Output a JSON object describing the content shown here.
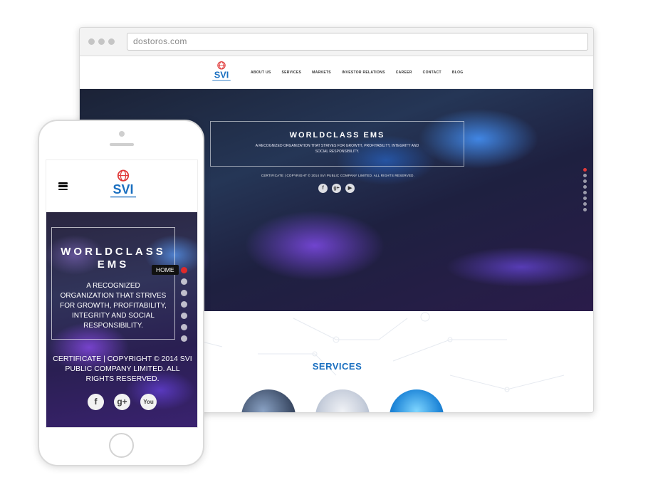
{
  "browser": {
    "url": "dostoros.com"
  },
  "brand": {
    "logo_text": "SVI",
    "accent_blue": "#1a6fc0",
    "accent_red": "#e03a3a"
  },
  "desktop_nav": {
    "items": [
      {
        "label": "ABOUT US"
      },
      {
        "label": "SERVICES"
      },
      {
        "label": "MARKETS"
      },
      {
        "label": "INVESTOR RELATIONS"
      },
      {
        "label": "CAREER"
      },
      {
        "label": "CONTACT"
      },
      {
        "label": "BLOG"
      }
    ]
  },
  "hero": {
    "title": "WORLDCLASS EMS",
    "subtitle": "A RECOGNIZED ORGANIZATION THAT STRIVES FOR GROWTH, PROFITABILITY, INTEGRITY AND SOCIAL RESPONSIBILITY.",
    "copyright": "CERTIFICATE | COPYRIGHT © 2014 SVI PUBLIC COMPANY LIMITED. ALL RIGHTS RESERVED.",
    "social": [
      {
        "icon": "facebook-icon",
        "glyph": "f"
      },
      {
        "icon": "google-plus-icon",
        "glyph": "g+"
      },
      {
        "icon": "youtube-icon",
        "glyph": "▶"
      }
    ]
  },
  "services": {
    "title": "SERVICES"
  },
  "mobile": {
    "menu_icon": "hamburger-icon",
    "title": "WORLDCLASS EMS",
    "subtitle": "A RECOGNIZED ORGANIZATION THAT STRIVES FOR GROWTH, PROFITABILITY, INTEGRITY AND SOCIAL RESPONSIBILITY.",
    "copyright": "CERTIFICATE | COPYRIGHT © 2014 SVI PUBLIC COMPANY LIMITED. ALL RIGHTS RESERVED.",
    "tooltip": "HOME",
    "social": [
      {
        "icon": "facebook-icon",
        "glyph": "f"
      },
      {
        "icon": "google-plus-icon",
        "glyph": "g+"
      },
      {
        "icon": "youtube-icon",
        "glyph": "You"
      }
    ]
  }
}
